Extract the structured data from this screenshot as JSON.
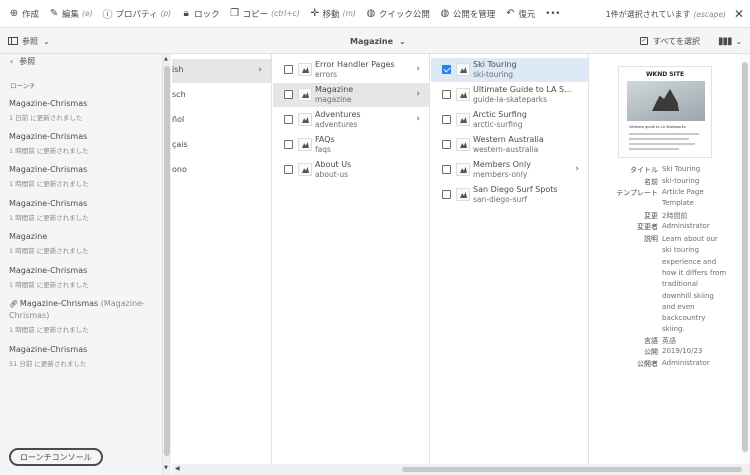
{
  "toolbar": {
    "items": [
      {
        "icon": "plus-circle-icon",
        "label": "作成",
        "hint": ""
      },
      {
        "icon": "pencil-icon",
        "label": "編集",
        "hint": "(e)"
      },
      {
        "icon": "info-icon",
        "label": "プロパティ",
        "hint": "(p)"
      },
      {
        "icon": "lock-icon",
        "label": "ロック",
        "hint": ""
      },
      {
        "icon": "copy-icon",
        "label": "コピー",
        "hint": "(ctrl+c)"
      },
      {
        "icon": "move-icon",
        "label": "移動",
        "hint": "(m)"
      },
      {
        "icon": "globe-icon",
        "label": "クイック公開",
        "hint": ""
      },
      {
        "icon": "globe-gear-icon",
        "label": "公開を管理",
        "hint": ""
      },
      {
        "icon": "undo-icon",
        "label": "復元",
        "hint": ""
      },
      {
        "icon": "more-icon",
        "label": "•••",
        "hint": ""
      }
    ],
    "selection_text": "1件が選択されています",
    "selection_hint": "(escape)",
    "close": "✕"
  },
  "subbar": {
    "rail_label": "参照",
    "title": "Magazine",
    "select_all": "すべてを選択"
  },
  "rail": {
    "back_label": "参照",
    "section": "ローンチ",
    "entries": [
      {
        "title": "Magazine-Chrismas",
        "sub": "",
        "time": "1 日前 に更新されました"
      },
      {
        "title": "Magazine-Chrismas",
        "sub": "",
        "time": "1 時間前 に更新されました"
      },
      {
        "title": "Magazine-Chrismas",
        "sub": "",
        "time": "1 時間前 に更新されました"
      },
      {
        "title": "Magazine-Chrismas",
        "sub": "",
        "time": "1 時間前 に更新されました"
      },
      {
        "title": "Magazine",
        "sub": "",
        "time": "1 時間前 に更新されました"
      },
      {
        "title": "Magazine-Chrismas",
        "sub": "",
        "time": "1 時間前 に更新されました"
      },
      {
        "title": "Magazine-Chrismas",
        "sub": "(Magazine-Chrismas)",
        "time": "1 時間前 に更新されました"
      },
      {
        "title": "Magazine-Chrismas",
        "sub": "",
        "time": "51 分前 に更新されました"
      }
    ],
    "console_button": "ローンチコンソール"
  },
  "column1": {
    "items": [
      "ish",
      "sch",
      "ñol",
      "çais",
      "ono"
    ]
  },
  "column2": {
    "items": [
      {
        "title": "Error Handler Pages",
        "name": "errors",
        "children": true,
        "selected": false
      },
      {
        "title": "Magazine",
        "name": "magazine",
        "children": true,
        "selected": true
      },
      {
        "title": "Adventures",
        "name": "adventures",
        "children": true,
        "selected": false
      },
      {
        "title": "FAQs",
        "name": "faqs",
        "children": false,
        "selected": false
      },
      {
        "title": "About Us",
        "name": "about-us",
        "children": false,
        "selected": false
      }
    ]
  },
  "column3": {
    "items": [
      {
        "title": "Ski Touring",
        "name": "ski-touring",
        "children": false,
        "checked": true
      },
      {
        "title": "Ultimate Guide to LA Skat…",
        "name": "guide-la-skateparks",
        "children": false,
        "checked": false
      },
      {
        "title": "Arctic Surfing",
        "name": "arctic-surfing",
        "children": false,
        "checked": false
      },
      {
        "title": "Western Australia",
        "name": "western-australia",
        "children": false,
        "checked": false
      },
      {
        "title": "Members Only",
        "name": "members-only",
        "children": true,
        "checked": false
      },
      {
        "title": "San Diego Surf Spots",
        "name": "san-diego-surf",
        "children": false,
        "checked": false
      }
    ]
  },
  "preview": {
    "brand": "WKND SITE",
    "headline": "Ultimate guide to LA Skateparks",
    "meta": {
      "title_k": "タイトル",
      "title_v": "Ski Touring",
      "name_k": "名前",
      "name_v": "ski-touring",
      "template_k": "テンプレート",
      "template_v1": "Article Page",
      "template_v2": "Template",
      "modified_k": "変更",
      "modified_v": "2時間前",
      "modified_by_k": "変更者",
      "modified_by_v": "Administrator",
      "desc_k": "説明",
      "desc_lines": [
        "Learn about our",
        "ski touring",
        "experience and",
        "how it differs from",
        "traditional",
        "downhill skiing",
        "and even",
        "backcountry",
        "skiing."
      ],
      "lang_k": "言語",
      "lang_v": "英語",
      "published_k": "公開",
      "published_v": "2019/10/23",
      "publisher_k": "公開者",
      "publisher_v": "Administrator"
    }
  }
}
